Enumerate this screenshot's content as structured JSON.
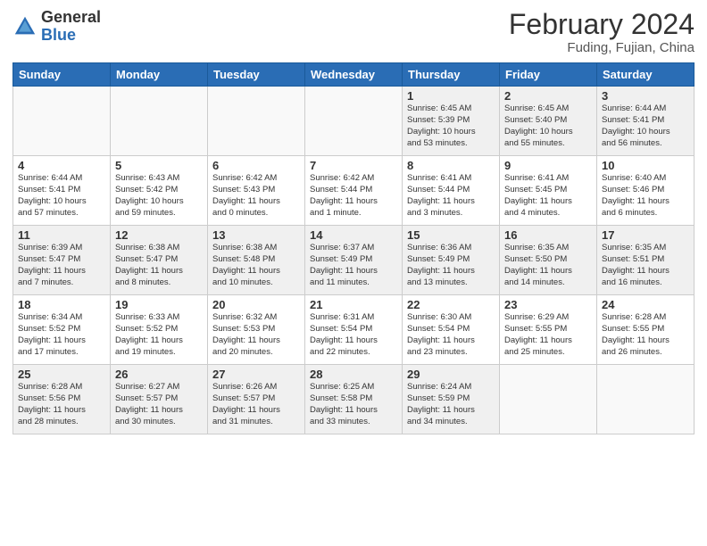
{
  "header": {
    "logo_general": "General",
    "logo_blue": "Blue",
    "month_year": "February 2024",
    "location": "Fuding, Fujian, China"
  },
  "weekdays": [
    "Sunday",
    "Monday",
    "Tuesday",
    "Wednesday",
    "Thursday",
    "Friday",
    "Saturday"
  ],
  "weeks": [
    [
      {
        "day": "",
        "info": ""
      },
      {
        "day": "",
        "info": ""
      },
      {
        "day": "",
        "info": ""
      },
      {
        "day": "",
        "info": ""
      },
      {
        "day": "1",
        "info": "Sunrise: 6:45 AM\nSunset: 5:39 PM\nDaylight: 10 hours\nand 53 minutes."
      },
      {
        "day": "2",
        "info": "Sunrise: 6:45 AM\nSunset: 5:40 PM\nDaylight: 10 hours\nand 55 minutes."
      },
      {
        "day": "3",
        "info": "Sunrise: 6:44 AM\nSunset: 5:41 PM\nDaylight: 10 hours\nand 56 minutes."
      }
    ],
    [
      {
        "day": "4",
        "info": "Sunrise: 6:44 AM\nSunset: 5:41 PM\nDaylight: 10 hours\nand 57 minutes."
      },
      {
        "day": "5",
        "info": "Sunrise: 6:43 AM\nSunset: 5:42 PM\nDaylight: 10 hours\nand 59 minutes."
      },
      {
        "day": "6",
        "info": "Sunrise: 6:42 AM\nSunset: 5:43 PM\nDaylight: 11 hours\nand 0 minutes."
      },
      {
        "day": "7",
        "info": "Sunrise: 6:42 AM\nSunset: 5:44 PM\nDaylight: 11 hours\nand 1 minute."
      },
      {
        "day": "8",
        "info": "Sunrise: 6:41 AM\nSunset: 5:44 PM\nDaylight: 11 hours\nand 3 minutes."
      },
      {
        "day": "9",
        "info": "Sunrise: 6:41 AM\nSunset: 5:45 PM\nDaylight: 11 hours\nand 4 minutes."
      },
      {
        "day": "10",
        "info": "Sunrise: 6:40 AM\nSunset: 5:46 PM\nDaylight: 11 hours\nand 6 minutes."
      }
    ],
    [
      {
        "day": "11",
        "info": "Sunrise: 6:39 AM\nSunset: 5:47 PM\nDaylight: 11 hours\nand 7 minutes."
      },
      {
        "day": "12",
        "info": "Sunrise: 6:38 AM\nSunset: 5:47 PM\nDaylight: 11 hours\nand 8 minutes."
      },
      {
        "day": "13",
        "info": "Sunrise: 6:38 AM\nSunset: 5:48 PM\nDaylight: 11 hours\nand 10 minutes."
      },
      {
        "day": "14",
        "info": "Sunrise: 6:37 AM\nSunset: 5:49 PM\nDaylight: 11 hours\nand 11 minutes."
      },
      {
        "day": "15",
        "info": "Sunrise: 6:36 AM\nSunset: 5:49 PM\nDaylight: 11 hours\nand 13 minutes."
      },
      {
        "day": "16",
        "info": "Sunrise: 6:35 AM\nSunset: 5:50 PM\nDaylight: 11 hours\nand 14 minutes."
      },
      {
        "day": "17",
        "info": "Sunrise: 6:35 AM\nSunset: 5:51 PM\nDaylight: 11 hours\nand 16 minutes."
      }
    ],
    [
      {
        "day": "18",
        "info": "Sunrise: 6:34 AM\nSunset: 5:52 PM\nDaylight: 11 hours\nand 17 minutes."
      },
      {
        "day": "19",
        "info": "Sunrise: 6:33 AM\nSunset: 5:52 PM\nDaylight: 11 hours\nand 19 minutes."
      },
      {
        "day": "20",
        "info": "Sunrise: 6:32 AM\nSunset: 5:53 PM\nDaylight: 11 hours\nand 20 minutes."
      },
      {
        "day": "21",
        "info": "Sunrise: 6:31 AM\nSunset: 5:54 PM\nDaylight: 11 hours\nand 22 minutes."
      },
      {
        "day": "22",
        "info": "Sunrise: 6:30 AM\nSunset: 5:54 PM\nDaylight: 11 hours\nand 23 minutes."
      },
      {
        "day": "23",
        "info": "Sunrise: 6:29 AM\nSunset: 5:55 PM\nDaylight: 11 hours\nand 25 minutes."
      },
      {
        "day": "24",
        "info": "Sunrise: 6:28 AM\nSunset: 5:55 PM\nDaylight: 11 hours\nand 26 minutes."
      }
    ],
    [
      {
        "day": "25",
        "info": "Sunrise: 6:28 AM\nSunset: 5:56 PM\nDaylight: 11 hours\nand 28 minutes."
      },
      {
        "day": "26",
        "info": "Sunrise: 6:27 AM\nSunset: 5:57 PM\nDaylight: 11 hours\nand 30 minutes."
      },
      {
        "day": "27",
        "info": "Sunrise: 6:26 AM\nSunset: 5:57 PM\nDaylight: 11 hours\nand 31 minutes."
      },
      {
        "day": "28",
        "info": "Sunrise: 6:25 AM\nSunset: 5:58 PM\nDaylight: 11 hours\nand 33 minutes."
      },
      {
        "day": "29",
        "info": "Sunrise: 6:24 AM\nSunset: 5:59 PM\nDaylight: 11 hours\nand 34 minutes."
      },
      {
        "day": "",
        "info": ""
      },
      {
        "day": "",
        "info": ""
      }
    ]
  ]
}
